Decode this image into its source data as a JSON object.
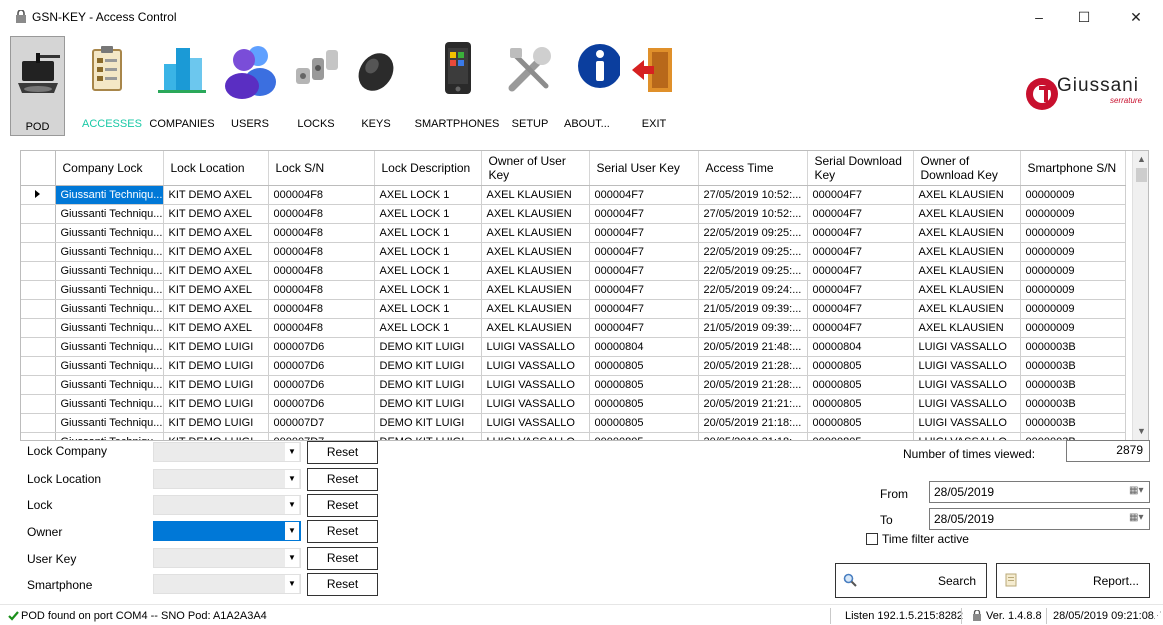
{
  "window": {
    "title": "GSN-KEY - Access Control",
    "minimize": "–",
    "maximize": "☐",
    "close": "✕"
  },
  "toolbar": {
    "items": [
      {
        "label": "POD",
        "icon": "pod-reader-icon",
        "active": true
      },
      {
        "label": "ACCESSES",
        "icon": "clipboard-icon"
      },
      {
        "label": "COMPANIES",
        "icon": "buildings-icon"
      },
      {
        "label": "USERS",
        "icon": "users-icon"
      },
      {
        "label": "LOCKS",
        "icon": "cylinder-locks-icon"
      },
      {
        "label": "KEYS",
        "icon": "key-fob-icon"
      },
      {
        "label": "SMARTPHONES",
        "icon": "smartphone-icon"
      },
      {
        "label": "SETUP",
        "icon": "tools-icon"
      },
      {
        "label": "ABOUT...",
        "icon": "info-icon"
      },
      {
        "label": "EXIT",
        "icon": "exit-door-icon"
      }
    ],
    "logo_text": "Giussani",
    "logo_sub": "serrature"
  },
  "grid": {
    "columns": [
      "Company Lock",
      "Lock Location",
      "Lock S/N",
      "Lock Description",
      "Owner of User Key",
      "Serial User Key",
      "Access Time",
      "Serial Download Key",
      "Owner of Download Key",
      "Smartphone S/N"
    ],
    "rows": [
      [
        "Giussanti Techniqu...",
        "KIT DEMO AXEL",
        "000004F8",
        "AXEL LOCK 1",
        "AXEL KLAUSIEN",
        "000004F7",
        "27/05/2019 10:52:...",
        "000004F7",
        "AXEL KLAUSIEN",
        "00000009"
      ],
      [
        "Giussanti Techniqu...",
        "KIT DEMO AXEL",
        "000004F8",
        "AXEL LOCK 1",
        "AXEL KLAUSIEN",
        "000004F7",
        "27/05/2019 10:52:...",
        "000004F7",
        "AXEL KLAUSIEN",
        "00000009"
      ],
      [
        "Giussanti Techniqu...",
        "KIT DEMO AXEL",
        "000004F8",
        "AXEL LOCK 1",
        "AXEL KLAUSIEN",
        "000004F7",
        "22/05/2019 09:25:...",
        "000004F7",
        "AXEL KLAUSIEN",
        "00000009"
      ],
      [
        "Giussanti Techniqu...",
        "KIT DEMO AXEL",
        "000004F8",
        "AXEL LOCK 1",
        "AXEL KLAUSIEN",
        "000004F7",
        "22/05/2019 09:25:...",
        "000004F7",
        "AXEL KLAUSIEN",
        "00000009"
      ],
      [
        "Giussanti Techniqu...",
        "KIT DEMO AXEL",
        "000004F8",
        "AXEL LOCK 1",
        "AXEL KLAUSIEN",
        "000004F7",
        "22/05/2019 09:25:...",
        "000004F7",
        "AXEL KLAUSIEN",
        "00000009"
      ],
      [
        "Giussanti Techniqu...",
        "KIT DEMO AXEL",
        "000004F8",
        "AXEL LOCK 1",
        "AXEL KLAUSIEN",
        "000004F7",
        "22/05/2019 09:24:...",
        "000004F7",
        "AXEL KLAUSIEN",
        "00000009"
      ],
      [
        "Giussanti Techniqu...",
        "KIT DEMO AXEL",
        "000004F8",
        "AXEL LOCK 1",
        "AXEL KLAUSIEN",
        "000004F7",
        "21/05/2019 09:39:...",
        "000004F7",
        "AXEL KLAUSIEN",
        "00000009"
      ],
      [
        "Giussanti Techniqu...",
        "KIT DEMO AXEL",
        "000004F8",
        "AXEL LOCK 1",
        "AXEL KLAUSIEN",
        "000004F7",
        "21/05/2019 09:39:...",
        "000004F7",
        "AXEL KLAUSIEN",
        "00000009"
      ],
      [
        "Giussanti Techniqu...",
        "KIT DEMO LUIGI",
        "000007D6",
        "DEMO KIT LUIGI",
        "LUIGI VASSALLO",
        "00000804",
        "20/05/2019 21:48:...",
        "00000804",
        "LUIGI VASSALLO",
        "0000003B"
      ],
      [
        "Giussanti Techniqu...",
        "KIT DEMO LUIGI",
        "000007D6",
        "DEMO KIT LUIGI",
        "LUIGI VASSALLO",
        "00000805",
        "20/05/2019 21:28:...",
        "00000805",
        "LUIGI VASSALLO",
        "0000003B"
      ],
      [
        "Giussanti Techniqu...",
        "KIT DEMO LUIGI",
        "000007D6",
        "DEMO KIT LUIGI",
        "LUIGI VASSALLO",
        "00000805",
        "20/05/2019 21:28:...",
        "00000805",
        "LUIGI VASSALLO",
        "0000003B"
      ],
      [
        "Giussanti Techniqu...",
        "KIT DEMO LUIGI",
        "000007D6",
        "DEMO KIT LUIGI",
        "LUIGI VASSALLO",
        "00000805",
        "20/05/2019 21:21:...",
        "00000805",
        "LUIGI VASSALLO",
        "0000003B"
      ],
      [
        "Giussanti Techniqu...",
        "KIT DEMO LUIGI",
        "000007D7",
        "DEMO KIT LUIGI",
        "LUIGI VASSALLO",
        "00000805",
        "20/05/2019 21:18:...",
        "00000805",
        "LUIGI VASSALLO",
        "0000003B"
      ],
      [
        "Giussanti Techniqu...",
        "KIT DEMO LUIGI",
        "000007D7",
        "DEMO KIT LUIGI",
        "LUIGI VASSALLO",
        "00000805",
        "20/05/2019 21:18:...",
        "00000805",
        "LUIGI VASSALLO",
        "0000003B"
      ]
    ]
  },
  "filters": {
    "reset_label": "Reset",
    "items": [
      {
        "label": "Lock Company",
        "value": ""
      },
      {
        "label": "Lock Location",
        "value": ""
      },
      {
        "label": "Lock",
        "value": ""
      },
      {
        "label": "Owner",
        "value": "",
        "highlighted": true
      },
      {
        "label": "User Key",
        "value": ""
      },
      {
        "label": "Smartphone",
        "value": ""
      }
    ]
  },
  "stats": {
    "views_label": "Number of times viewed:",
    "views_value": "2879"
  },
  "date_filter": {
    "from_label": "From",
    "from_value": "28/05/2019",
    "to_label": "To",
    "to_value": "28/05/2019",
    "time_filter_label": "Time filter active",
    "time_filter_checked": false
  },
  "actions": {
    "search_label": "Search",
    "report_label": "Report..."
  },
  "statusbar": {
    "pod_status": "POD found on port COM4 -- SNO Pod: A1A2A3A4",
    "listen": "Listen 192.1.5.215:8282",
    "version": "Ver. 1.4.8.8",
    "datetime": "28/05/2019 09:21:08"
  },
  "colors": {
    "selection": "#0078d7",
    "accesses_label": "#19c9a6",
    "logo_red": "#c8102e",
    "status_ok": "#1a8f1a"
  }
}
